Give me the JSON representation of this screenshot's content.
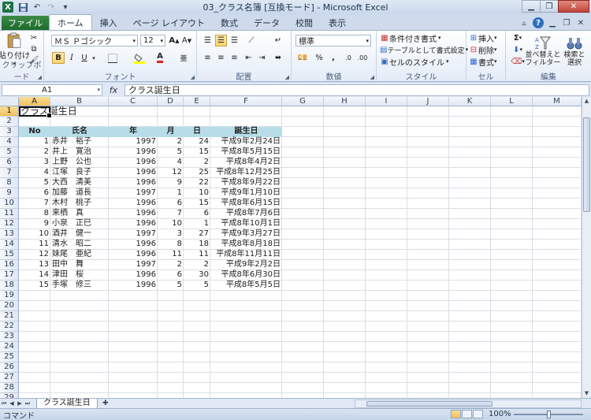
{
  "window": {
    "title": "03_クラス名簿 [互換モード] - Microsoft Excel",
    "app_icon": "X"
  },
  "ribbon_tabs": [
    "ファイル",
    "ホーム",
    "挿入",
    "ページ レイアウト",
    "数式",
    "データ",
    "校閲",
    "表示"
  ],
  "active_tab": "ホーム",
  "ribbon": {
    "clipboard": {
      "label": "クリップボード",
      "paste": "貼り付け"
    },
    "font": {
      "label": "フォント",
      "font_name": "ＭＳ Ｐゴシック",
      "font_size": "12",
      "bold": "B",
      "italic": "I",
      "underline": "U"
    },
    "alignment": {
      "label": "配置"
    },
    "number": {
      "label": "数値",
      "format": "標準"
    },
    "styles": {
      "label": "スタイル",
      "cond_format": "条件付き書式",
      "table_format": "テーブルとして書式設定",
      "cell_styles": "セルのスタイル"
    },
    "cells": {
      "label": "セル",
      "insert": "挿入",
      "delete": "削除",
      "format": "書式"
    },
    "editing": {
      "label": "編集",
      "sum": "Σ",
      "sort": "並べ替えと フィルター",
      "sort_line1": "並べ替えと",
      "sort_line2": "フィルター",
      "find_line1": "検索と",
      "find_line2": "選択"
    }
  },
  "formula_bar": {
    "name_box": "A1",
    "fx": "fx",
    "content": "クラス誕生日"
  },
  "columns": [
    "A",
    "B",
    "C",
    "D",
    "E",
    "F",
    "G",
    "H",
    "I",
    "J",
    "K",
    "L",
    "M"
  ],
  "rows": [
    "1",
    "2",
    "3",
    "4",
    "5",
    "6",
    "7",
    "8",
    "9",
    "10",
    "11",
    "12",
    "13",
    "14",
    "15",
    "16",
    "17",
    "18",
    "19",
    "20",
    "21",
    "22",
    "23",
    "24",
    "25",
    "26",
    "27",
    "28",
    "29"
  ],
  "sheet": {
    "title": "クラス誕生日",
    "headers": [
      "No",
      "氏名",
      "年",
      "月",
      "日",
      "誕生日"
    ],
    "records": [
      [
        "1",
        "赤井　裕子",
        "1997",
        "2",
        "24",
        "平成9年2月24日"
      ],
      [
        "2",
        "井上　寛治",
        "1996",
        "5",
        "15",
        "平成8年5月15日"
      ],
      [
        "3",
        "上野　公也",
        "1996",
        "4",
        "2",
        "平成8年4月2日"
      ],
      [
        "4",
        "江塚　良子",
        "1996",
        "12",
        "25",
        "平成8年12月25日"
      ],
      [
        "5",
        "大西　清美",
        "1996",
        "9",
        "22",
        "平成8年9月22日"
      ],
      [
        "6",
        "加藤　道長",
        "1997",
        "1",
        "10",
        "平成9年1月10日"
      ],
      [
        "7",
        "木村　桃子",
        "1996",
        "6",
        "15",
        "平成8年6月15日"
      ],
      [
        "8",
        "来栖　真",
        "1996",
        "7",
        "6",
        "平成8年7月6日"
      ],
      [
        "9",
        "小泉　正巳",
        "1996",
        "10",
        "1",
        "平成8年10月1日"
      ],
      [
        "10",
        "酒井　健一",
        "1997",
        "3",
        "27",
        "平成9年3月27日"
      ],
      [
        "11",
        "清水　昭二",
        "1996",
        "8",
        "18",
        "平成8年8月18日"
      ],
      [
        "12",
        "妹尾　亜紀",
        "1996",
        "11",
        "11",
        "平成8年11月11日"
      ],
      [
        "13",
        "田中　舞",
        "1997",
        "2",
        "2",
        "平成9年2月2日"
      ],
      [
        "14",
        "津田　桜",
        "1996",
        "6",
        "30",
        "平成8年6月30日"
      ],
      [
        "15",
        "手塚　修三",
        "1996",
        "5",
        "5",
        "平成8年5月5日"
      ]
    ]
  },
  "sheet_tabs": [
    "クラス誕生日"
  ],
  "status": {
    "mode": "コマンド",
    "zoom": "100%"
  },
  "colors": {
    "header_fill": "#b7dde8",
    "file_tab": "#1d6b2b",
    "selection": "#111111"
  }
}
